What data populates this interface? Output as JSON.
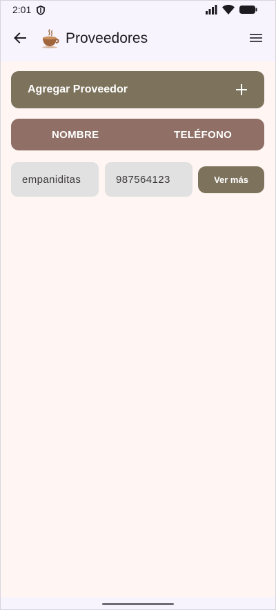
{
  "status_bar": {
    "time": "2:01",
    "icons": [
      "shield-icon",
      "signal-icon",
      "wifi-icon",
      "battery-icon"
    ]
  },
  "app_bar": {
    "title": "Proveedores",
    "back_icon": "arrow-back-icon",
    "logo_icon": "coffee-cup-icon",
    "menu_icon": "hamburger-menu-icon"
  },
  "actions": {
    "add_label": "Agregar Proveedor",
    "add_icon": "plus-icon"
  },
  "table": {
    "columns": [
      "NOMBRE",
      "TELÉFONO"
    ],
    "rows": [
      {
        "name": "empaniditas",
        "phone": "987564123",
        "action": "Ver más"
      }
    ]
  },
  "colors": {
    "primary": "#7d735d",
    "header": "#8f6f66",
    "background": "#fff6f3",
    "cell": "#e1e1e1",
    "bar": "#f8f4fd"
  }
}
